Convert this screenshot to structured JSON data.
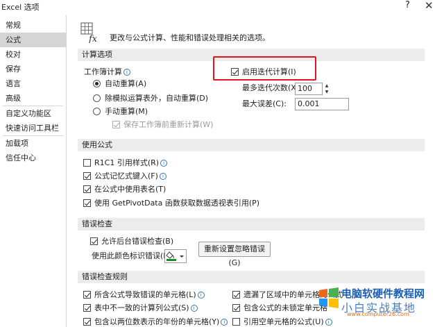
{
  "window": {
    "title": "Excel 选项",
    "help": "?",
    "close": "✕"
  },
  "sidebar": {
    "items": [
      {
        "label": "常规"
      },
      {
        "label": "公式"
      },
      {
        "label": "校对"
      },
      {
        "label": "保存"
      },
      {
        "label": "语言"
      },
      {
        "label": "高级"
      },
      {
        "label": "自定义功能区"
      },
      {
        "label": "快速访问工具栏"
      },
      {
        "label": "加载项"
      },
      {
        "label": "信任中心"
      }
    ],
    "selected": "公式"
  },
  "intro": {
    "text": "更改与公式计算、性能和错误处理相关的选项。",
    "icon": "fx-icon"
  },
  "calc": {
    "header": "计算选项",
    "workbook_label": "工作簿计算",
    "auto": "自动重算(A)",
    "auto_except": "除模拟运算表外，自动重算(D)",
    "manual": "手动重算(M)",
    "recalc_before_save": "保存工作簿前重新计算(W)",
    "iterative": "启用迭代计算(I)",
    "max_iter_label": "最多迭代次数(X):",
    "max_iter_value": "100",
    "max_change_label": "最大误差(C):",
    "max_change_value": "0.001",
    "selected_mode": "auto"
  },
  "formulas": {
    "header": "使用公式",
    "r1c1": "R1C1 引用样式(R)",
    "autocomplete": "公式记忆式键入(F)",
    "table_names": "在公式中使用表名(T)",
    "getpivot": "使用 GetPivotData 函数获取数据透视表引用(P)"
  },
  "errors": {
    "header": "错误检查",
    "bg_check": "允许后台错误检查(B)",
    "color_label": "使用此颜色标识错误(E):",
    "reset_button": "重新设置忽略错误(G)"
  },
  "rules": {
    "header": "错误检查规则",
    "r1": "所含公式导致错误的单元格(L)",
    "r2": "表中不一致的计算列公式(S)",
    "r3": "包含以两位数表示的年份的单元格(Y)",
    "r4": "遗漏了区域中的单元格的公式",
    "r5": "包含公式的未锁定单元格",
    "r6": "引用空单元格的公式(U)"
  },
  "watermark": {
    "title": "电脑软硬件教程网",
    "subtitle": "小白实战基地",
    "url": "www.computer26.com"
  },
  "colors": {
    "highlight": "#e0141e",
    "info": "#2e75b6",
    "watermark_blue": "#1a5fb4",
    "watermark_orange": "#e8691e"
  }
}
